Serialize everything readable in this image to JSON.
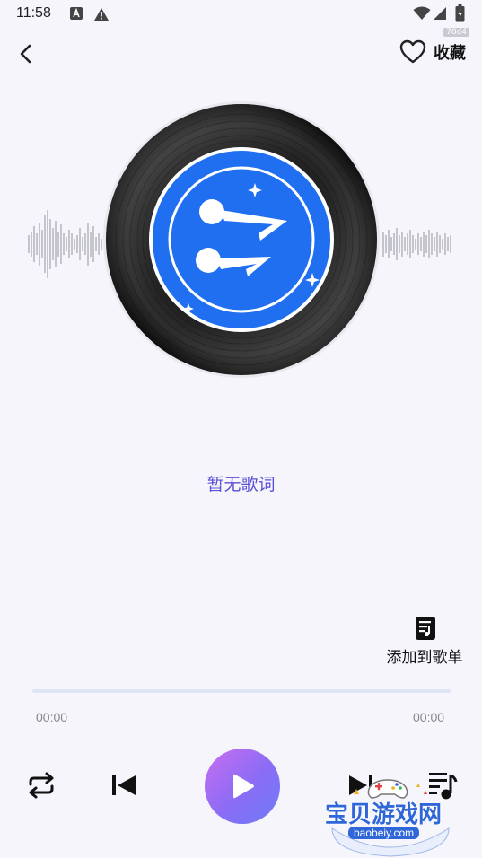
{
  "status_bar": {
    "time": "11:58",
    "icons": [
      "notification-a-icon",
      "warning-icon",
      "wifi-icon",
      "signal-icon",
      "battery-icon"
    ]
  },
  "header": {
    "back_icon": "chevron-left-icon",
    "favorite_label": "收藏",
    "version_badge": "78d4"
  },
  "player": {
    "lyrics_text": "暂无歌词",
    "add_to_playlist_label": "添加到歌单",
    "elapsed_time": "00:00",
    "total_time": "00:00",
    "progress_fraction": 0
  },
  "controls": {
    "repeat_icon": "repeat-icon",
    "previous_icon": "skip-previous-icon",
    "play_icon": "play-icon",
    "next_icon": "skip-next-icon",
    "playlist_icon": "playlist-music-icon"
  },
  "watermark": {
    "text": "宝贝游戏网",
    "url": "baobeiy.com"
  },
  "colors": {
    "background": "#f5f5fb",
    "lyrics": "#5a4fd6",
    "play_gradient_start": "#c86ef0",
    "play_gradient_end": "#6d7cf7",
    "disc_label": "#1f6ff0",
    "progress_track": "#dce6f7"
  }
}
